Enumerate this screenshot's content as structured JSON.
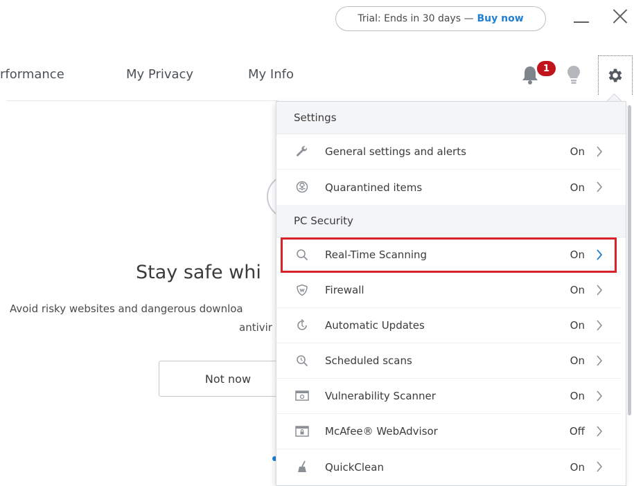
{
  "window": {
    "trial_text": "Trial: Ends in 30 days —",
    "buy_label": "Buy now"
  },
  "nav": {
    "items": [
      "rformance",
      "My Privacy",
      "My Info"
    ],
    "notification_count": "1"
  },
  "background": {
    "title": "Stay safe whi",
    "description_line1": "Avoid risky websites and dangerous downloa",
    "description_line2": "antivir",
    "not_now_label": "Not now"
  },
  "dropdown": {
    "sections": [
      {
        "header": "Settings",
        "items": [
          {
            "icon": "wrench-icon",
            "label": "General settings and alerts",
            "status": "On"
          },
          {
            "icon": "biohazard-icon",
            "label": "Quarantined items",
            "status": "On"
          }
        ]
      },
      {
        "header": "PC Security",
        "items": [
          {
            "icon": "search-icon",
            "label": "Real-Time Scanning",
            "status": "On"
          },
          {
            "icon": "shield-icon",
            "label": "Firewall",
            "status": "On"
          },
          {
            "icon": "update-icon",
            "label": "Automatic Updates",
            "status": "On"
          },
          {
            "icon": "scheduled-scan-icon",
            "label": "Scheduled scans",
            "status": "On"
          },
          {
            "icon": "vulnerability-icon",
            "label": "Vulnerability Scanner",
            "status": "On"
          },
          {
            "icon": "webadvisor-icon",
            "label": "McAfee® WebAdvisor",
            "status": "Off"
          },
          {
            "icon": "broom-icon",
            "label": "QuickClean",
            "status": "On"
          }
        ]
      }
    ]
  },
  "colors": {
    "accent_blue": "#1f7fd1",
    "badge_red": "#c0141c",
    "highlight_red": "#d9222a",
    "icon_gray": "#8b9096"
  }
}
